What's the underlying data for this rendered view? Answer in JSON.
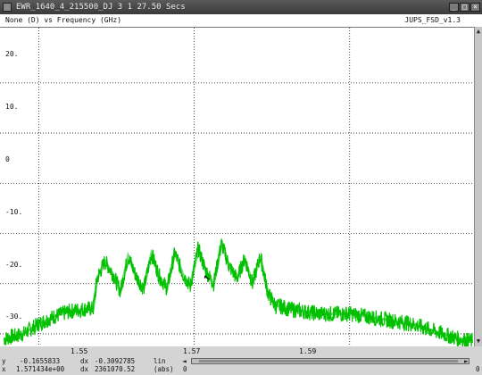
{
  "window": {
    "title": "EWR_1640_4_215500_DJ 3 1 27.50 Secs",
    "minimize_glyph": "_",
    "maximize_glyph": "□",
    "close_glyph": "×"
  },
  "menu": {
    "left_text": "None (D) vs Frequency (GHz)",
    "right_text": "JUPS_FSD_v1.3"
  },
  "plot": {
    "background": "#ffffff",
    "trace_color": "#00c000",
    "cursor_glyph": "↖"
  },
  "chart_data": {
    "type": "line",
    "title": "None (D) vs Frequency (GHz)",
    "xlabel": "Frequency (GHz)",
    "ylabel": "None (D)",
    "xlim": [
      1.545,
      1.606
    ],
    "ylim": [
      -32.5,
      31.0
    ],
    "x_ticks": [
      1.55,
      1.56,
      1.57,
      1.58,
      1.59,
      1.6
    ],
    "x_tick_labels": [
      "1.55",
      "",
      "1.57",
      "",
      "1.59",
      ""
    ],
    "y_ticks": [
      20,
      10,
      0,
      -10,
      -20,
      -30
    ],
    "y_tick_labels": [
      "20.",
      "10.",
      "0",
      "-10.",
      "-20.",
      "-30."
    ],
    "grid": "dotted",
    "series": [
      {
        "x": [
          1.5455,
          1.548,
          1.55,
          1.552,
          1.554,
          1.556,
          1.557,
          1.5575,
          1.5585,
          1.5595,
          1.5605,
          1.5615,
          1.5625,
          1.5635,
          1.5645,
          1.5655,
          1.5665,
          1.5675,
          1.5685,
          1.5695,
          1.5705,
          1.5715,
          1.5725,
          1.5735,
          1.5745,
          1.5755,
          1.5765,
          1.5775,
          1.5785,
          1.5795,
          1.5805,
          1.5812,
          1.582,
          1.584,
          1.586,
          1.588,
          1.59,
          1.592,
          1.594,
          1.596,
          1.598,
          1.6,
          1.602,
          1.604,
          1.6058
        ],
        "y": [
          -31.0,
          -30.0,
          -28.0,
          -26.5,
          -25.5,
          -25.0,
          -25.0,
          -19.0,
          -15.5,
          -18.0,
          -21.5,
          -14.5,
          -18.5,
          -21.0,
          -14.0,
          -18.5,
          -21.0,
          -13.8,
          -18.0,
          -20.5,
          -13.0,
          -17.5,
          -20.0,
          -12.0,
          -16.5,
          -19.0,
          -15.0,
          -20.0,
          -14.5,
          -22.0,
          -24.5,
          -24.5,
          -25.0,
          -25.5,
          -26.0,
          -26.0,
          -26.0,
          -26.5,
          -27.0,
          -27.5,
          -28.0,
          -29.0,
          -30.0,
          -31.0,
          -31.5
        ]
      }
    ]
  },
  "status": {
    "row1": {
      "axis": "y",
      "value": "-0.1655833",
      "delta_label": "dx",
      "delta_value": "-0.3092785",
      "scale": "lin"
    },
    "row2": {
      "axis": "x",
      "value": "1.571434e+00",
      "delta_label": "dx",
      "delta_value": "2361070.52",
      "mode": "(abs)"
    }
  },
  "hscrollbar": {
    "left_arrow": "◄",
    "right_arrow": "►",
    "left_number": "0",
    "right_number": "0"
  }
}
